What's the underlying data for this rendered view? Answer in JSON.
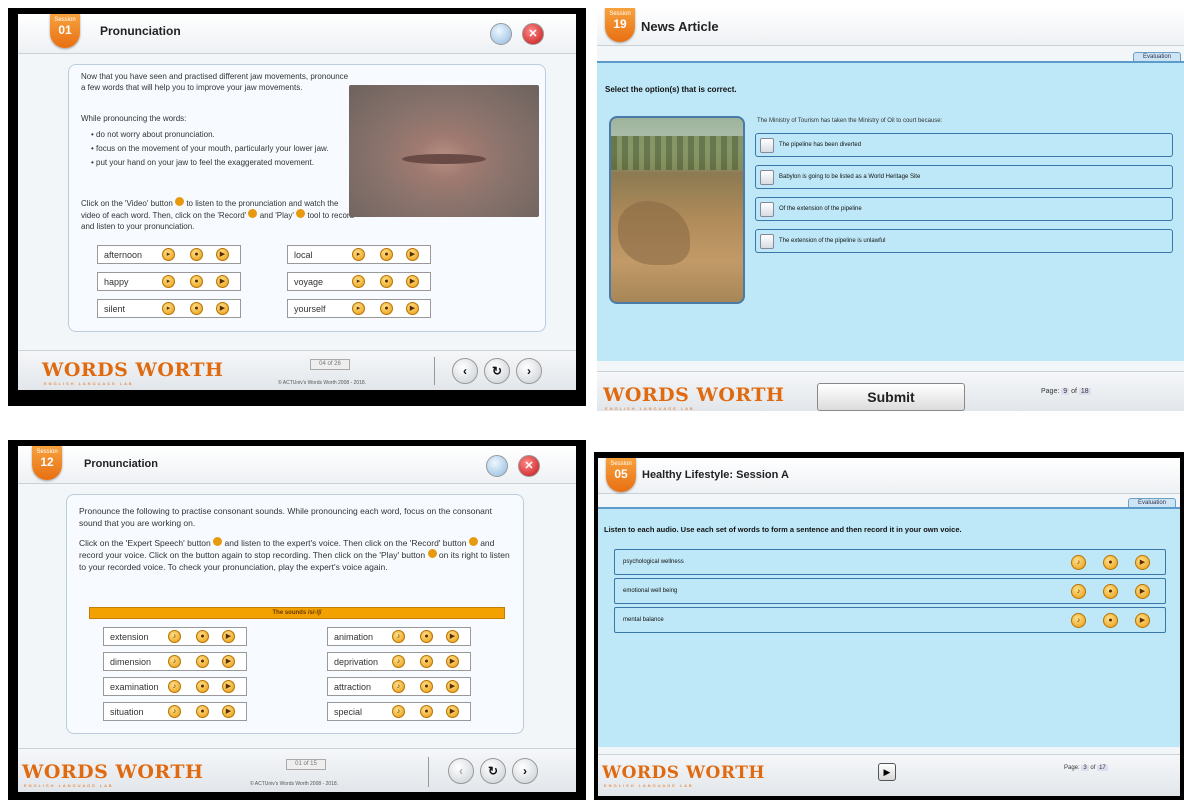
{
  "brand": {
    "logo": "WORDS WORTH",
    "logo_sub": "ENGLISH LANGUAGE LAB",
    "copyright": "© ACTUniv's Words Worth 2008 - 2018.",
    "session_label": "Session"
  },
  "colors": {
    "accent": "#e86f12",
    "quiz_bg": "#bee8f7",
    "border_blue": "#3a77a8"
  },
  "icons": {
    "expert": "expert-speech-icon",
    "record": "record-icon",
    "play": "play-icon",
    "video": "video-icon"
  },
  "panel1": {
    "session": "01",
    "title": "Pronunciation",
    "intro": "Now that you have seen and practised different jaw movements, pronounce a few words that will help you to improve your jaw movements.",
    "while": "While pronouncing the words:",
    "bullets": [
      "do not worry about pronunciation.",
      "focus on the movement of your mouth, particularly your lower jaw.",
      "put your hand on your jaw to feel the exaggerated movement."
    ],
    "instruction_1": "Click on the 'Video' button",
    "instruction_2": "to listen to the pronunciation and watch the video of each word. Then, click on the 'Record'",
    "instruction_3": "and 'Play'",
    "instruction_4": "tool to record and listen to your pronunciation.",
    "words_left": [
      "afternoon",
      "happy",
      "silent"
    ],
    "words_right": [
      "local",
      "voyage",
      "yourself"
    ],
    "page": "04 of 26"
  },
  "panel2": {
    "session": "19",
    "title": "News Article",
    "tab": "Evaluation",
    "instruction": "Select the option(s) that is correct.",
    "question": "The Ministry of Tourism has taken the Ministry of Oil to court because:",
    "options": [
      "The pipeline has been diverted",
      "Babylon is going to be listed as a World Heritage Site",
      "Of the extension of the pipeline",
      "The extension of the pipeline is unlawful"
    ],
    "submit": "Submit",
    "page_label": "Page:",
    "page_num": "9",
    "page_of": "of",
    "page_total": "18"
  },
  "panel3": {
    "session": "12",
    "title": "Pronunciation",
    "p1": "Pronounce the following to practise consonant sounds. While pronouncing each word, focus on the consonant sound that you are working on.",
    "p2a": "Click on the 'Expert Speech' button",
    "p2b": "and listen to the expert's voice. Then click on the 'Record' button",
    "p2c": "and record your voice. Click on the button again to stop recording. Then click on the 'Play' button",
    "p2d": "on its right to listen to your recorded voice. To check your pronunciation, play the expert's voice again.",
    "sounds": "The sounds /s/-/∫/",
    "words_left": [
      "extension",
      "dimension",
      "examination",
      "situation"
    ],
    "words_right": [
      "animation",
      "deprivation",
      "attraction",
      "special"
    ],
    "page": "01 of 15"
  },
  "panel4": {
    "session": "05",
    "title": "Healthy Lifestyle: Session A",
    "tab": "Evaluation",
    "instruction": "Listen to each audio. Use each set of words to form a sentence and then record it in your own voice.",
    "rows": [
      "psychological wellness",
      "emotional well being",
      "mental balance"
    ],
    "page_label": "Page:",
    "page_num": "3",
    "page_of": "of",
    "page_total": "17"
  }
}
